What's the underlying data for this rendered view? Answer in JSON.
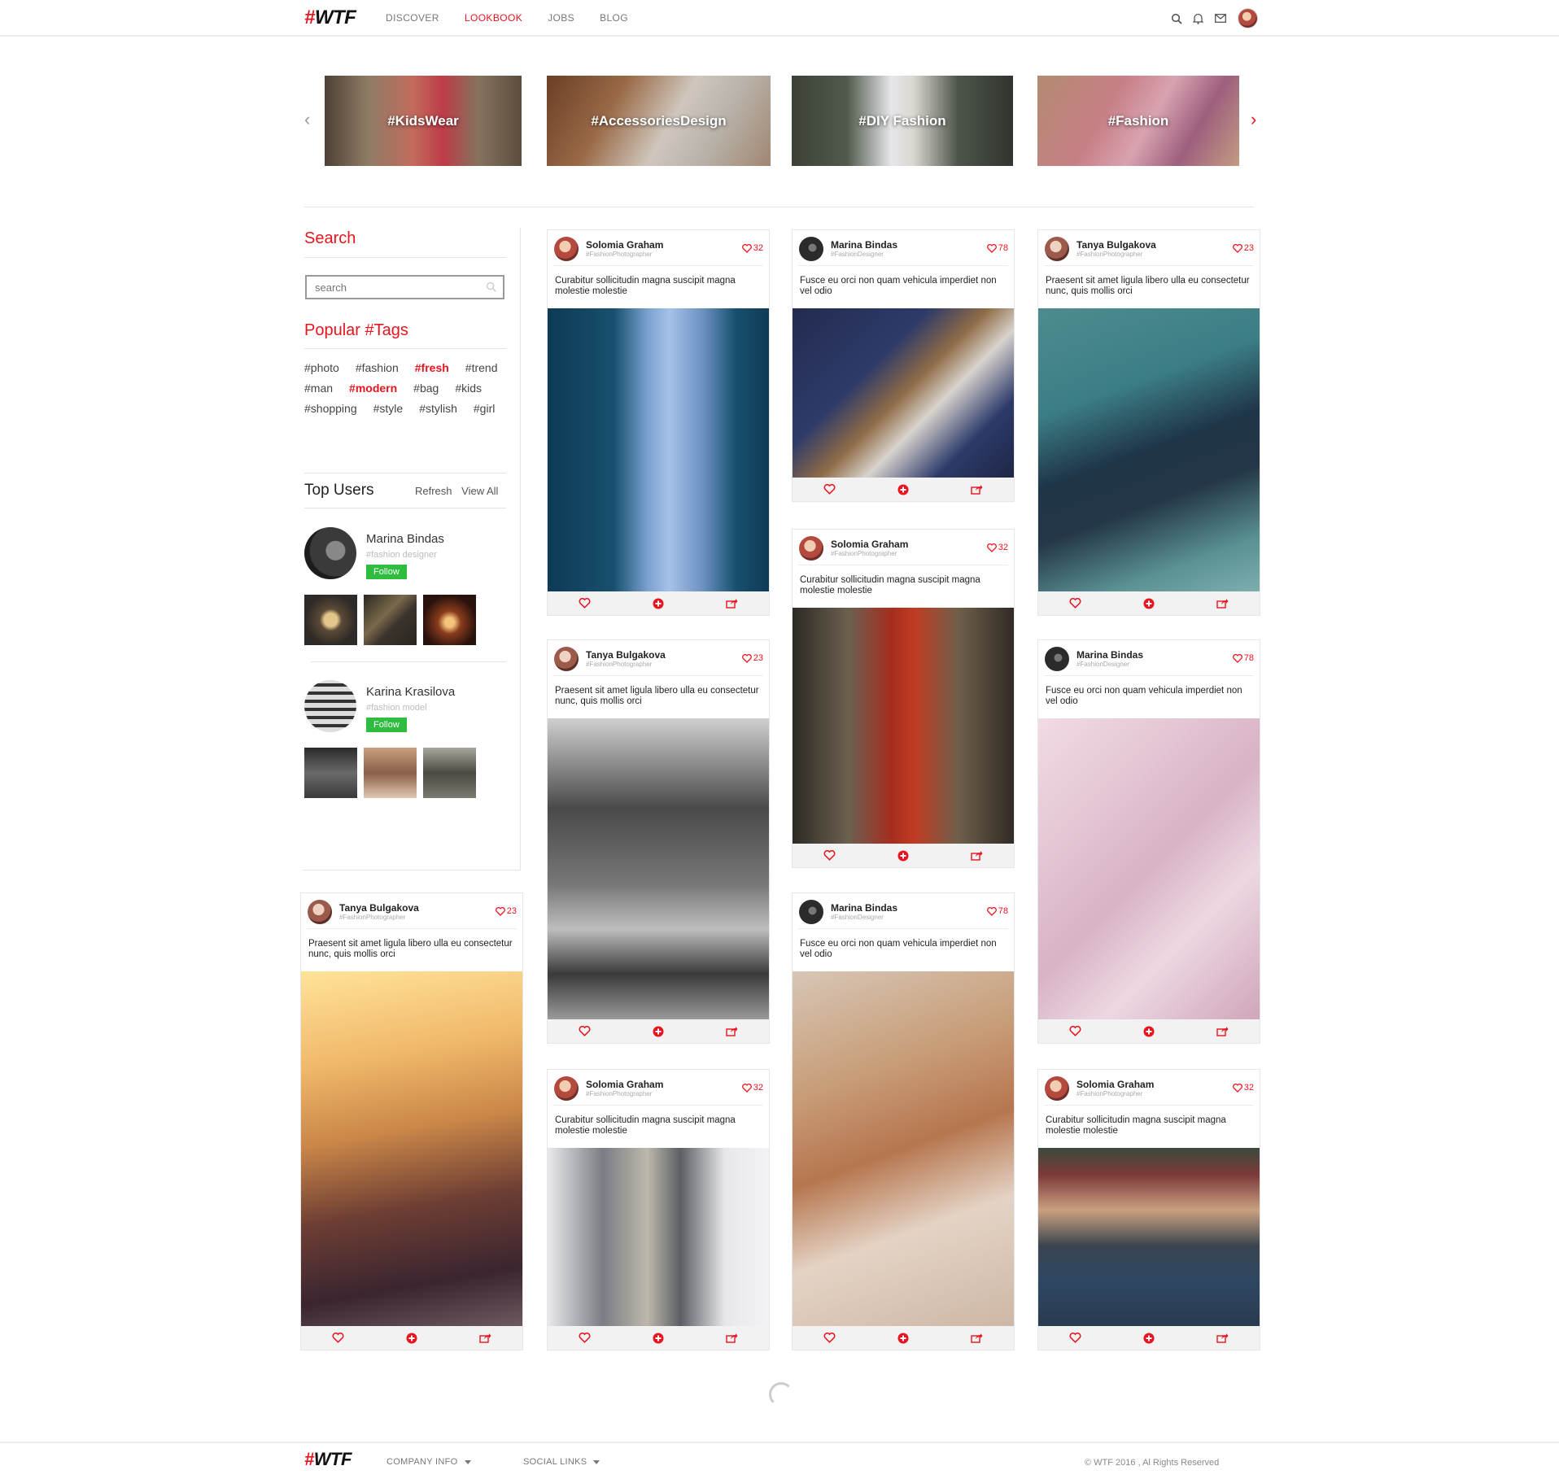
{
  "header": {
    "logo_hash": "#",
    "logo_text": "WTF",
    "nav": [
      "DISCOVER",
      "LOOKBOOK",
      "JOBS",
      "BLOG"
    ],
    "active_nav": "LOOKBOOK",
    "icons": [
      "search-icon",
      "bell-icon",
      "mail-icon",
      "user-avatar"
    ]
  },
  "categories": [
    "#KidsWear",
    "#AccessoriesDesign",
    "#DIY Fashion",
    "#Fashion"
  ],
  "sidebar": {
    "search_title": "Search",
    "search_placeholder": "search",
    "tags_title": "Popular #Tags",
    "tag_rows": [
      [
        "#photo",
        "#fashion",
        "#fresh",
        "#trend"
      ],
      [
        "#man",
        "#modern",
        "#bag",
        "#kids"
      ],
      [
        "#shopping",
        "#style",
        "#stylish",
        "#girl"
      ]
    ],
    "highlighted_tags": [
      "#fresh",
      "#modern"
    ],
    "top_users_title": "Top Users",
    "refresh_label": "Refresh",
    "view_all_label": "View All",
    "users": [
      {
        "name": "Marina Bindas",
        "role": "#fashion designer",
        "follow": "Follow"
      },
      {
        "name": "Karina Krasilova",
        "role": "#fashion model",
        "follow": "Follow"
      }
    ]
  },
  "cards": [
    {
      "name": "Solomia Graham",
      "sub": "#FashionPhotographer",
      "likes": "32",
      "desc": "Curabitur sollicitudin magna suscipit magna molestie molestie"
    },
    {
      "name": "Marina Bindas",
      "sub": "#FashionDesigner",
      "likes": "78",
      "desc": "Fusce eu orci non quam vehicula imperdiet non vel odio"
    },
    {
      "name": "Tanya Bulgakova",
      "sub": "#FashionPhotographer",
      "likes": "23",
      "desc": "Praesent sit amet ligula libero ulla eu consectetur nunc, quis mollis orci"
    },
    {
      "name": "Solomia Graham",
      "sub": "#FashionPhotographer",
      "likes": "32",
      "desc": "Curabitur sollicitudin magna suscipit magna molestie molestie"
    },
    {
      "name": "Tanya Bulgakova",
      "sub": "#FashionPhotographer",
      "likes": "23",
      "desc": "Praesent sit amet ligula libero ulla eu consectetur nunc, quis mollis orci"
    },
    {
      "name": "Marina Bindas",
      "sub": "#FashionDesigner",
      "likes": "78",
      "desc": "Fusce eu orci non quam vehicula imperdiet non vel odio"
    },
    {
      "name": "Tanya Bulgakova",
      "sub": "#FashionPhotographer",
      "likes": "23",
      "desc": "Praesent sit amet ligula libero ulla eu consectetur nunc, quis mollis orci"
    },
    {
      "name": "Marina Bindas",
      "sub": "#FashionDesigner",
      "likes": "78",
      "desc": "Fusce eu orci non quam vehicula imperdiet non vel odio"
    },
    {
      "name": "Solomia Graham",
      "sub": "#FashionPhotographer",
      "likes": "32",
      "desc": "Curabitur sollicitudin magna suscipit magna molestie molestie"
    },
    {
      "name": "Solomia Graham",
      "sub": "#FashionPhotographer",
      "likes": "32",
      "desc": "Curabitur sollicitudin magna suscipit magna molestie molestie"
    }
  ],
  "footer": {
    "logo_hash": "#",
    "logo_text": "WTF",
    "company_info": "COMPANY INFO",
    "social_links": "SOCIAL LINKS",
    "copyright": "© WTF 2016 , Al Rights Reserved"
  },
  "colors": {
    "accent": "#e8141e",
    "follow": "#2ebd3e"
  }
}
